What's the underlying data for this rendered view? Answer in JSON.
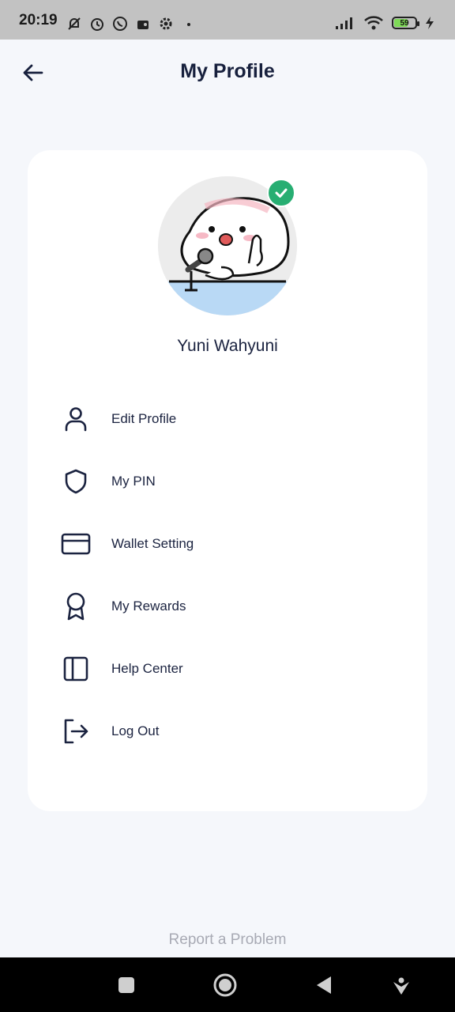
{
  "status_bar": {
    "time": "20:19",
    "battery_level": "59",
    "battery_fill_fraction": 0.59,
    "battery_color": "#7ed957",
    "left_icons": [
      "bell-off-icon",
      "alarm-icon",
      "whatsapp-icon",
      "radio-icon",
      "settings-gear-icon",
      "dot-icon"
    ],
    "right_icons": [
      "signal-icon",
      "wifi-icon",
      "battery-icon",
      "charging-icon"
    ]
  },
  "header": {
    "title": "My Profile",
    "back_icon": "arrow-left-icon"
  },
  "profile": {
    "name": "Yuni Wahyuni",
    "verified": true,
    "verified_color": "#27ae72"
  },
  "menu": {
    "items": [
      {
        "label": "Edit Profile",
        "icon": "user-icon"
      },
      {
        "label": "My PIN",
        "icon": "shield-icon"
      },
      {
        "label": "Wallet Setting",
        "icon": "credit-card-icon"
      },
      {
        "label": "My Rewards",
        "icon": "award-icon"
      },
      {
        "label": "Help Center",
        "icon": "sidebar-panel-icon"
      },
      {
        "label": "Log Out",
        "icon": "logout-icon"
      }
    ]
  },
  "footer": {
    "report_label": "Report a Problem"
  },
  "nav_bar": {
    "buttons": [
      "recent-apps-icon",
      "home-icon",
      "back-triangle-icon",
      "down-arrow-icon"
    ]
  },
  "colors": {
    "background": "#f5f7fb",
    "card": "#ffffff",
    "text_primary": "#1b2340",
    "muted": "#a8aab4"
  }
}
